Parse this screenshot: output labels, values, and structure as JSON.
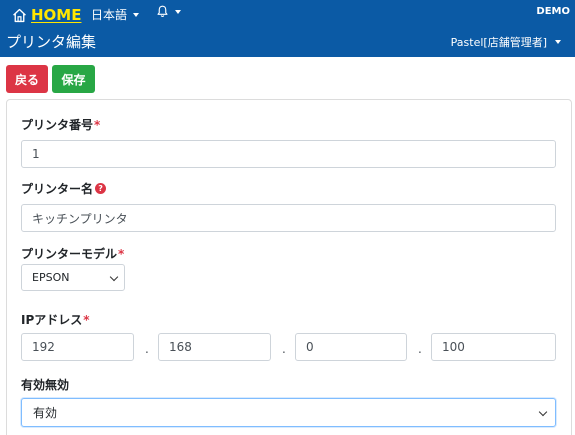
{
  "header": {
    "home_label": "HOME",
    "language_label": "日本語",
    "environment_label": "DEMO",
    "page_title": "プリンタ編集",
    "user_label": "Pastel[店舗管理者]"
  },
  "toolbar": {
    "back_label": "戻る",
    "save_label": "保存"
  },
  "form": {
    "printer_number": {
      "label": "プリンタ番号",
      "required_mark": "*",
      "value": "1"
    },
    "printer_name": {
      "label": "プリンター名",
      "help_mark": "?",
      "value": "キッチンプリンタ"
    },
    "printer_model": {
      "label": "プリンターモデル",
      "required_mark": "*",
      "selected": "EPSON"
    },
    "ip_address": {
      "label": "IPアドレス",
      "required_mark": "*",
      "octets": [
        "192",
        "168",
        "0",
        "100"
      ],
      "separator": "."
    },
    "enabled": {
      "label": "有効無効",
      "selected": "有効"
    }
  },
  "colors": {
    "header_bg": "#0b5aa5",
    "home_text": "#ffe600",
    "back_button": "#dc3545",
    "save_button": "#28a745",
    "required": "#dc3545"
  },
  "icons": {
    "home": "home-icon",
    "bell": "bell-icon",
    "help": "question-circle-icon",
    "dropdown": "chevron-down-icon"
  }
}
